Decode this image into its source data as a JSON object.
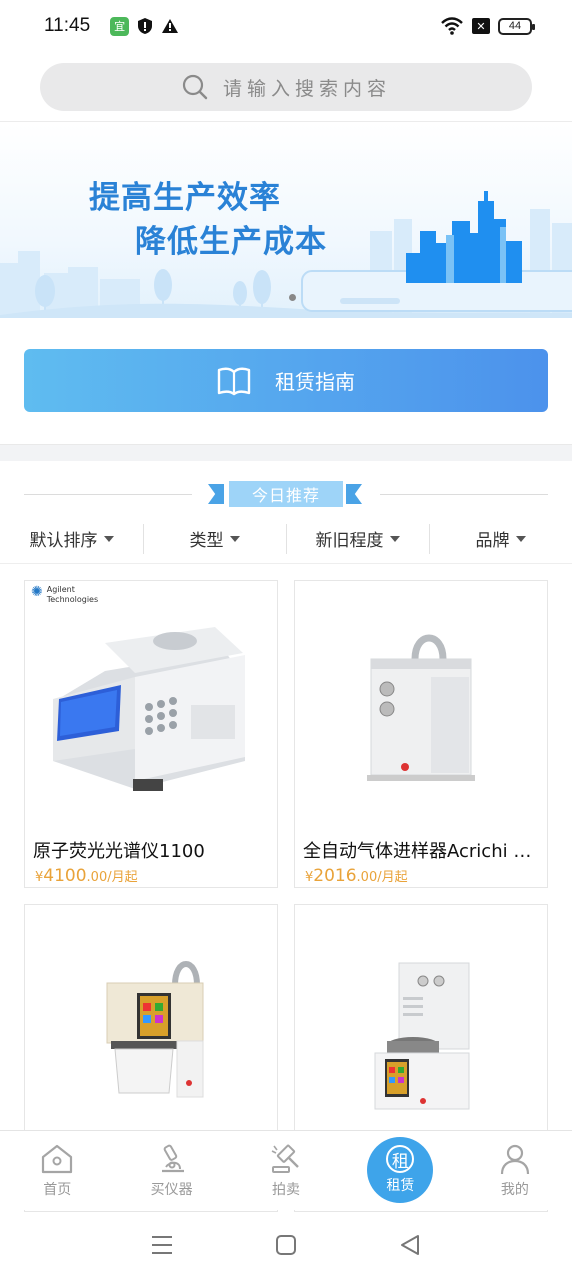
{
  "status_bar": {
    "time": "11:45",
    "app_badge": "宜",
    "battery": "44"
  },
  "search": {
    "placeholder": "请输入搜索内容"
  },
  "banner": {
    "line1": "提高生产效率",
    "line2": "降低生产成本"
  },
  "guide_button": {
    "label": "租赁指南"
  },
  "recommend": {
    "title": "今日推荐"
  },
  "filters": [
    {
      "label": "默认排序"
    },
    {
      "label": "类型"
    },
    {
      "label": "新旧程度"
    },
    {
      "label": "品牌"
    }
  ],
  "products": [
    {
      "title": "原子荧光光谱仪1100",
      "currency": "¥",
      "price_int": "4100",
      "price_suffix": ".00/月起",
      "brand_line1": "Agilent",
      "brand_line2": "Technologies"
    },
    {
      "title": "全自动气体进样器Acrichi O...",
      "currency": "¥",
      "price_int": "2016",
      "price_suffix": ".00/月起"
    },
    {
      "title": ""
    },
    {
      "title": ""
    }
  ],
  "bottom_nav": [
    {
      "label": "首页",
      "icon": "home-icon"
    },
    {
      "label": "买仪器",
      "icon": "microscope-icon"
    },
    {
      "label": "拍卖",
      "icon": "gavel-icon"
    },
    {
      "label": "租赁",
      "icon": "rent-icon",
      "glyph": "租",
      "active": true
    },
    {
      "label": "我的",
      "icon": "user-icon"
    }
  ],
  "colors": {
    "accent": "#3ea4ea",
    "price": "#e9a33a",
    "banner_text": "#2a82d6",
    "guide_gradient_start": "#5fbcf0",
    "guide_gradient_end": "#4c92ec"
  }
}
